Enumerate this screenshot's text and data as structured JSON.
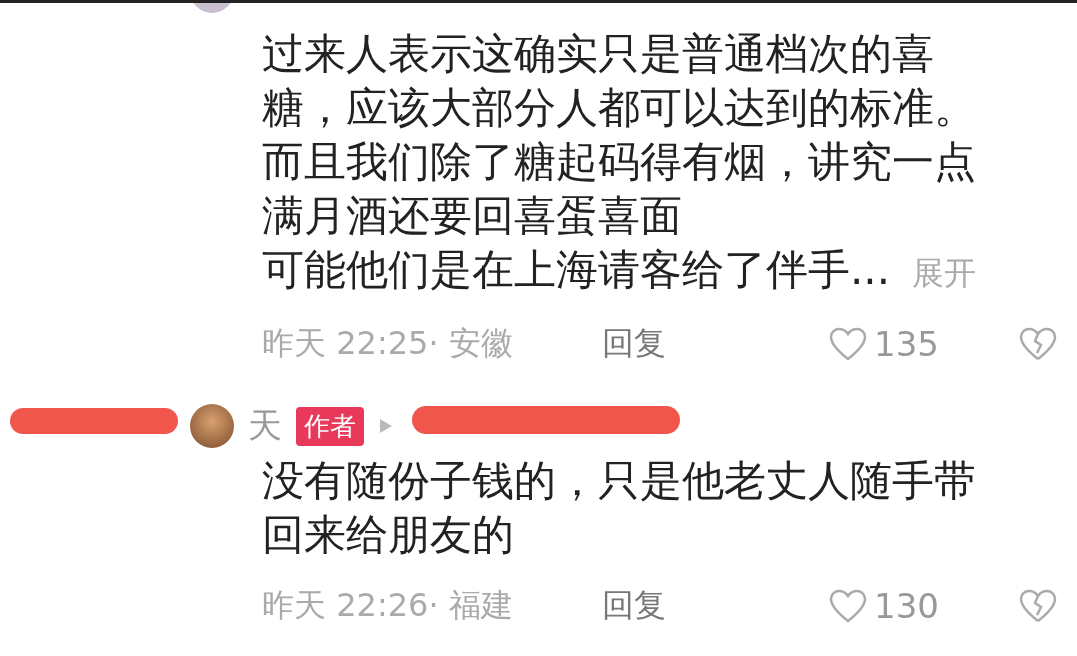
{
  "comments": [
    {
      "lines": [
        "过来人表示这确实只是普通档次的喜",
        "糖，应该大部分人都可以达到的标准。",
        "而且我们除了糖起码得有烟，讲究一点",
        "满月酒还要回喜蛋喜面",
        "可能他们是在上海请客给了伴手..."
      ],
      "expand": "展开",
      "time": "昨天 22:25· 安徽",
      "reply": "回复",
      "likes": "135"
    },
    {
      "author": "天",
      "author_badge": "作者",
      "lines": [
        "没有随份子钱的，只是他老丈人随手带",
        "回来给朋友的"
      ],
      "time": "昨天 22:26· 福建",
      "reply": "回复",
      "likes": "130"
    }
  ]
}
